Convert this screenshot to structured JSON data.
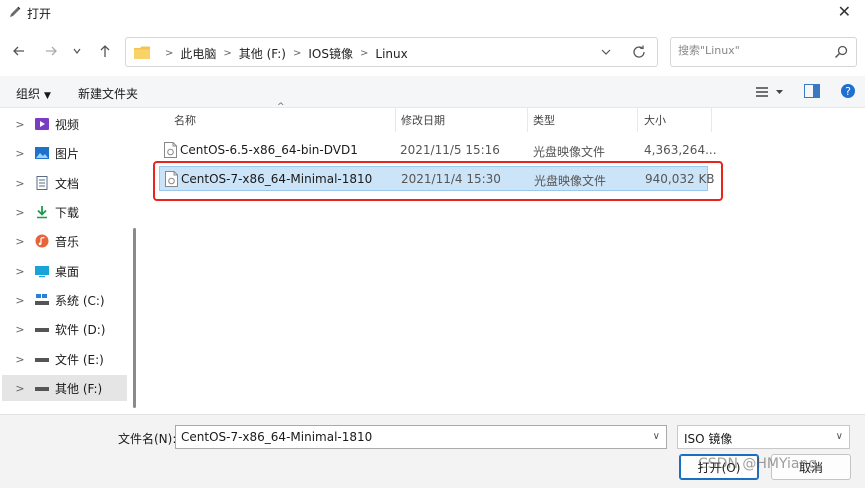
{
  "window": {
    "title": "打开",
    "close_glyph": "✕"
  },
  "nav": {
    "crumbs": [
      "此电脑",
      "其他 (F:)",
      "IOS镜像",
      "Linux"
    ],
    "search_placeholder": "搜索\"Linux\""
  },
  "toolbar": {
    "organize_label": "组织",
    "new_folder_label": "新建文件夹"
  },
  "sidebar": {
    "items": [
      {
        "label": "视频",
        "icon": "video-icon"
      },
      {
        "label": "图片",
        "icon": "pictures-icon"
      },
      {
        "label": "文档",
        "icon": "documents-icon"
      },
      {
        "label": "下载",
        "icon": "download-icon"
      },
      {
        "label": "音乐",
        "icon": "music-icon"
      },
      {
        "label": "桌面",
        "icon": "desktop-icon"
      },
      {
        "label": "系统 (C:)",
        "icon": "windows-drive-icon"
      },
      {
        "label": "软件 (D:)",
        "icon": "drive-icon"
      },
      {
        "label": "文件 (E:)",
        "icon": "drive-icon"
      },
      {
        "label": "其他 (F:)",
        "icon": "drive-icon"
      }
    ]
  },
  "columns": {
    "name": "名称",
    "date": "修改日期",
    "type": "类型",
    "size": "大小"
  },
  "files": [
    {
      "name": "CentOS-6.5-x86_64-bin-DVD1",
      "date": "2021/11/5 15:16",
      "type": "光盘映像文件",
      "size": "4,363,264..."
    },
    {
      "name": "CentOS-7-x86_64-Minimal-1810",
      "date": "2021/11/4 15:30",
      "type": "光盘映像文件",
      "size": "940,032 KB"
    }
  ],
  "footer": {
    "filename_label": "文件名(N):",
    "filename_value": "CentOS-7-x86_64-Minimal-1810",
    "filetype_value": "ISO 镜像",
    "open_label": "打开(O)",
    "cancel_label": "取消",
    "watermark": "CSDN @HMYiang"
  },
  "colors": {
    "selection_bg": "#cce4f7",
    "selection_border": "#99c9ef",
    "annotation_red": "#e8241c",
    "primary_button_border": "#1b6ec2"
  }
}
